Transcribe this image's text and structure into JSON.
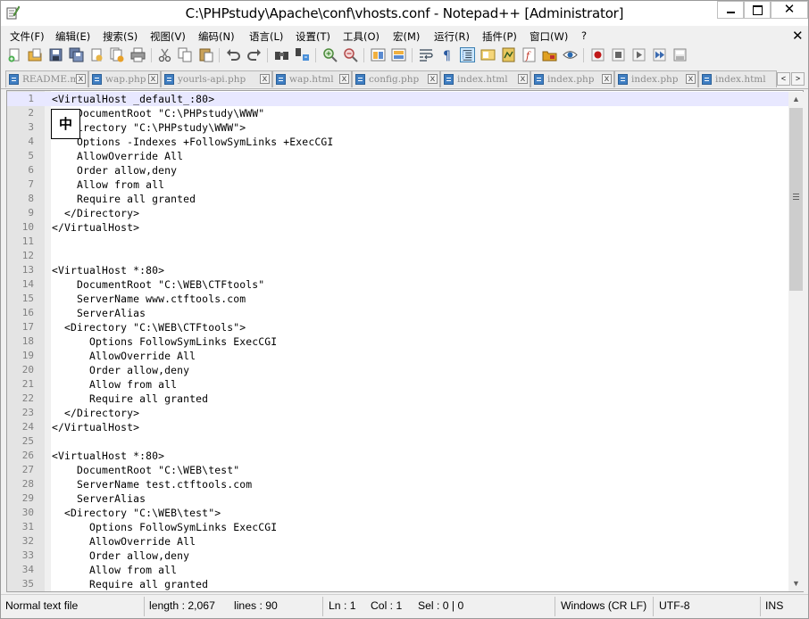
{
  "window": {
    "title": "C:\\PHPstudy\\Apache\\conf\\vhosts.conf - Notepad++ [Administrator]",
    "close_glyph": "✕"
  },
  "menu": {
    "items": [
      "文件(F)",
      "编辑(E)",
      "搜索(S)",
      "视图(V)",
      "编码(N)",
      "语言(L)",
      "设置(T)",
      "工具(O)",
      "宏(M)",
      "运行(R)",
      "插件(P)",
      "窗口(W)",
      "?"
    ],
    "close_glyph": "✕"
  },
  "tabs": [
    {
      "label": "README.md",
      "close": "x"
    },
    {
      "label": "wap.php",
      "close": "x"
    },
    {
      "label": "yourls-api.php",
      "close": "x"
    },
    {
      "label": "wap.html",
      "close": "x"
    },
    {
      "label": "config.php",
      "close": "x"
    },
    {
      "label": "index.html",
      "close": "x"
    },
    {
      "label": "index.php",
      "close": "x"
    },
    {
      "label": "index.php",
      "close": "x"
    },
    {
      "label": "index.html",
      "close": "x"
    }
  ],
  "tab_nav": {
    "prev": "<",
    "next": ">"
  },
  "ime_indicator": "中",
  "editor": {
    "lines": [
      {
        "n": "1",
        "code": "<VirtualHost _default_:80>"
      },
      {
        "n": "2",
        "code": "    DocumentRoot \"C:\\PHPstudy\\WWW\""
      },
      {
        "n": "3",
        "code": "  <Directory \"C:\\PHPstudy\\WWW\">"
      },
      {
        "n": "4",
        "code": "    Options -Indexes +FollowSymLinks +ExecCGI"
      },
      {
        "n": "5",
        "code": "    AllowOverride All"
      },
      {
        "n": "6",
        "code": "    Order allow,deny"
      },
      {
        "n": "7",
        "code": "    Allow from all"
      },
      {
        "n": "8",
        "code": "    Require all granted"
      },
      {
        "n": "9",
        "code": "  </Directory>"
      },
      {
        "n": "10",
        "code": "</VirtualHost>"
      },
      {
        "n": "11",
        "code": ""
      },
      {
        "n": "12",
        "code": ""
      },
      {
        "n": "13",
        "code": "<VirtualHost *:80>"
      },
      {
        "n": "14",
        "code": "    DocumentRoot \"C:\\WEB\\CTFtools\""
      },
      {
        "n": "15",
        "code": "    ServerName www.ctftools.com"
      },
      {
        "n": "16",
        "code": "    ServerAlias"
      },
      {
        "n": "17",
        "code": "  <Directory \"C:\\WEB\\CTFtools\">"
      },
      {
        "n": "18",
        "code": "      Options FollowSymLinks ExecCGI"
      },
      {
        "n": "19",
        "code": "      AllowOverride All"
      },
      {
        "n": "20",
        "code": "      Order allow,deny"
      },
      {
        "n": "21",
        "code": "      Allow from all"
      },
      {
        "n": "22",
        "code": "      Require all granted"
      },
      {
        "n": "23",
        "code": "  </Directory>"
      },
      {
        "n": "24",
        "code": "</VirtualHost>"
      },
      {
        "n": "25",
        "code": ""
      },
      {
        "n": "26",
        "code": "<VirtualHost *:80>"
      },
      {
        "n": "27",
        "code": "    DocumentRoot \"C:\\WEB\\test\""
      },
      {
        "n": "28",
        "code": "    ServerName test.ctftools.com"
      },
      {
        "n": "29",
        "code": "    ServerAlias"
      },
      {
        "n": "30",
        "code": "  <Directory \"C:\\WEB\\test\">"
      },
      {
        "n": "31",
        "code": "      Options FollowSymLinks ExecCGI"
      },
      {
        "n": "32",
        "code": "      AllowOverride All"
      },
      {
        "n": "33",
        "code": "      Order allow,deny"
      },
      {
        "n": "34",
        "code": "      Allow from all"
      },
      {
        "n": "35",
        "code": "      Require all granted"
      }
    ]
  },
  "scrollbar": {
    "up": "▲",
    "down": "▼"
  },
  "status": {
    "file_type": "Normal text file",
    "length": "length : 2,067",
    "lines": "lines : 90",
    "ln": "Ln : 1",
    "col": "Col : 1",
    "sel": "Sel : 0 | 0",
    "eol": "Windows (CR LF)",
    "encoding": "UTF-8",
    "mode": "INS"
  }
}
